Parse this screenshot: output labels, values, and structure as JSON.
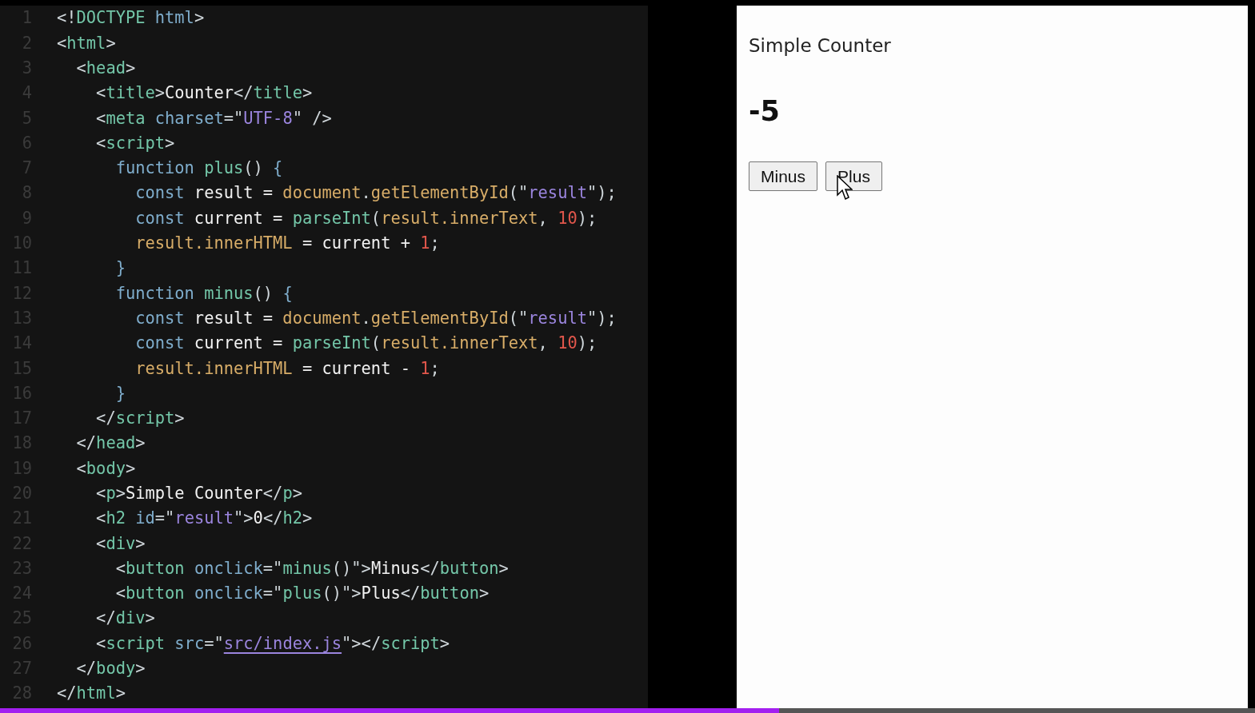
{
  "editor": {
    "lines": [
      {
        "n": "1",
        "tokens": [
          {
            "kind": "p",
            "text": "<!"
          },
          {
            "kind": "tag",
            "text": "DOCTYPE"
          },
          {
            "kind": "attr",
            "text": " html"
          },
          {
            "kind": "p",
            "text": ">"
          }
        ]
      },
      {
        "n": "2",
        "tokens": [
          {
            "kind": "p",
            "text": "<"
          },
          {
            "kind": "tag",
            "text": "html"
          },
          {
            "kind": "p",
            "text": ">"
          }
        ]
      },
      {
        "n": "3",
        "tokens": [
          {
            "kind": "p",
            "text": "  <"
          },
          {
            "kind": "tag",
            "text": "head"
          },
          {
            "kind": "p",
            "text": ">"
          }
        ]
      },
      {
        "n": "4",
        "tokens": [
          {
            "kind": "p",
            "text": "    <"
          },
          {
            "kind": "tag",
            "text": "title"
          },
          {
            "kind": "p",
            "text": ">"
          },
          {
            "kind": "txt",
            "text": "Counter"
          },
          {
            "kind": "p",
            "text": "</"
          },
          {
            "kind": "tag",
            "text": "title"
          },
          {
            "kind": "p",
            "text": ">"
          }
        ]
      },
      {
        "n": "5",
        "tokens": [
          {
            "kind": "p",
            "text": "    <"
          },
          {
            "kind": "tag",
            "text": "meta"
          },
          {
            "kind": "attr",
            "text": " charset"
          },
          {
            "kind": "p",
            "text": "=\""
          },
          {
            "kind": "str",
            "text": "UTF-8"
          },
          {
            "kind": "p",
            "text": "\" />"
          }
        ]
      },
      {
        "n": "6",
        "tokens": [
          {
            "kind": "p",
            "text": "    <"
          },
          {
            "kind": "tag",
            "text": "script"
          },
          {
            "kind": "p",
            "text": ">"
          }
        ]
      },
      {
        "n": "7",
        "tokens": [
          {
            "kind": "kw",
            "text": "      function"
          },
          {
            "kind": "fn",
            "text": " plus"
          },
          {
            "kind": "p",
            "text": "() "
          },
          {
            "kind": "kw",
            "text": "{"
          }
        ]
      },
      {
        "n": "8",
        "tokens": [
          {
            "kind": "kw",
            "text": "        const"
          },
          {
            "kind": "txt",
            "text": " result = "
          },
          {
            "kind": "obj",
            "text": "document"
          },
          {
            "kind": "p",
            "text": "."
          },
          {
            "kind": "obj",
            "text": "getElementById"
          },
          {
            "kind": "p",
            "text": "(\""
          },
          {
            "kind": "str",
            "text": "result"
          },
          {
            "kind": "p",
            "text": "\");"
          }
        ]
      },
      {
        "n": "9",
        "tokens": [
          {
            "kind": "kw",
            "text": "        const"
          },
          {
            "kind": "txt",
            "text": " current = "
          },
          {
            "kind": "fn",
            "text": "parseInt"
          },
          {
            "kind": "p",
            "text": "("
          },
          {
            "kind": "obj",
            "text": "result.innerText"
          },
          {
            "kind": "p",
            "text": ", "
          },
          {
            "kind": "num",
            "text": "10"
          },
          {
            "kind": "p",
            "text": ");"
          }
        ]
      },
      {
        "n": "10",
        "tokens": [
          {
            "kind": "obj",
            "text": "        result.innerHTML"
          },
          {
            "kind": "txt",
            "text": " = current + "
          },
          {
            "kind": "num",
            "text": "1"
          },
          {
            "kind": "p",
            "text": ";"
          }
        ]
      },
      {
        "n": "11",
        "tokens": [
          {
            "kind": "kw",
            "text": "      }"
          }
        ]
      },
      {
        "n": "12",
        "tokens": [
          {
            "kind": "kw",
            "text": "      function"
          },
          {
            "kind": "fn",
            "text": " minus"
          },
          {
            "kind": "p",
            "text": "() "
          },
          {
            "kind": "kw",
            "text": "{"
          }
        ]
      },
      {
        "n": "13",
        "tokens": [
          {
            "kind": "kw",
            "text": "        const"
          },
          {
            "kind": "txt",
            "text": " result = "
          },
          {
            "kind": "obj",
            "text": "document"
          },
          {
            "kind": "p",
            "text": "."
          },
          {
            "kind": "obj",
            "text": "getElementById"
          },
          {
            "kind": "p",
            "text": "(\""
          },
          {
            "kind": "str",
            "text": "result"
          },
          {
            "kind": "p",
            "text": "\");"
          }
        ]
      },
      {
        "n": "14",
        "tokens": [
          {
            "kind": "kw",
            "text": "        const"
          },
          {
            "kind": "txt",
            "text": " current = "
          },
          {
            "kind": "fn",
            "text": "parseInt"
          },
          {
            "kind": "p",
            "text": "("
          },
          {
            "kind": "obj",
            "text": "result.innerText"
          },
          {
            "kind": "p",
            "text": ", "
          },
          {
            "kind": "num",
            "text": "10"
          },
          {
            "kind": "p",
            "text": ");"
          }
        ]
      },
      {
        "n": "15",
        "tokens": [
          {
            "kind": "obj",
            "text": "        result.innerHTML"
          },
          {
            "kind": "txt",
            "text": " = current - "
          },
          {
            "kind": "num",
            "text": "1"
          },
          {
            "kind": "p",
            "text": ";"
          }
        ]
      },
      {
        "n": "16",
        "tokens": [
          {
            "kind": "kw",
            "text": "      }"
          }
        ]
      },
      {
        "n": "17",
        "tokens": [
          {
            "kind": "p",
            "text": "    </"
          },
          {
            "kind": "tag",
            "text": "script"
          },
          {
            "kind": "p",
            "text": ">"
          }
        ]
      },
      {
        "n": "18",
        "tokens": [
          {
            "kind": "p",
            "text": "  </"
          },
          {
            "kind": "tag",
            "text": "head"
          },
          {
            "kind": "p",
            "text": ">"
          }
        ]
      },
      {
        "n": "19",
        "tokens": [
          {
            "kind": "p",
            "text": "  <"
          },
          {
            "kind": "tag",
            "text": "body"
          },
          {
            "kind": "p",
            "text": ">"
          }
        ]
      },
      {
        "n": "20",
        "tokens": [
          {
            "kind": "p",
            "text": "    <"
          },
          {
            "kind": "tag",
            "text": "p"
          },
          {
            "kind": "p",
            "text": ">"
          },
          {
            "kind": "txt",
            "text": "Simple Counter"
          },
          {
            "kind": "p",
            "text": "</"
          },
          {
            "kind": "tag",
            "text": "p"
          },
          {
            "kind": "p",
            "text": ">"
          }
        ]
      },
      {
        "n": "21",
        "tokens": [
          {
            "kind": "p",
            "text": "    <"
          },
          {
            "kind": "tag",
            "text": "h2"
          },
          {
            "kind": "attr",
            "text": " id"
          },
          {
            "kind": "p",
            "text": "=\""
          },
          {
            "kind": "str",
            "text": "result"
          },
          {
            "kind": "p",
            "text": "\">"
          },
          {
            "kind": "txt",
            "text": "0"
          },
          {
            "kind": "p",
            "text": "</"
          },
          {
            "kind": "tag",
            "text": "h2"
          },
          {
            "kind": "p",
            "text": ">"
          }
        ]
      },
      {
        "n": "22",
        "tokens": [
          {
            "kind": "p",
            "text": "    <"
          },
          {
            "kind": "tag",
            "text": "div"
          },
          {
            "kind": "p",
            "text": ">"
          }
        ]
      },
      {
        "n": "23",
        "tokens": [
          {
            "kind": "p",
            "text": "      <"
          },
          {
            "kind": "tag",
            "text": "button"
          },
          {
            "kind": "attr",
            "text": " onclick"
          },
          {
            "kind": "p",
            "text": "=\""
          },
          {
            "kind": "fn",
            "text": "minus"
          },
          {
            "kind": "p",
            "text": "()\">"
          },
          {
            "kind": "txt",
            "text": "Minus"
          },
          {
            "kind": "p",
            "text": "</"
          },
          {
            "kind": "tag",
            "text": "button"
          },
          {
            "kind": "p",
            "text": ">"
          }
        ]
      },
      {
        "n": "24",
        "tokens": [
          {
            "kind": "p",
            "text": "      <"
          },
          {
            "kind": "tag",
            "text": "button"
          },
          {
            "kind": "attr",
            "text": " onclick"
          },
          {
            "kind": "p",
            "text": "=\""
          },
          {
            "kind": "fn",
            "text": "plus"
          },
          {
            "kind": "p",
            "text": "()\">"
          },
          {
            "kind": "txt",
            "text": "Plus"
          },
          {
            "kind": "p",
            "text": "</"
          },
          {
            "kind": "tag",
            "text": "button"
          },
          {
            "kind": "p",
            "text": ">"
          }
        ]
      },
      {
        "n": "25",
        "tokens": [
          {
            "kind": "p",
            "text": "    </"
          },
          {
            "kind": "tag",
            "text": "div"
          },
          {
            "kind": "p",
            "text": ">"
          }
        ]
      },
      {
        "n": "26",
        "tokens": [
          {
            "kind": "p",
            "text": "    <"
          },
          {
            "kind": "tag",
            "text": "script"
          },
          {
            "kind": "attr",
            "text": " src"
          },
          {
            "kind": "p",
            "text": "=\""
          },
          {
            "kind": "link",
            "text": "src/index.js"
          },
          {
            "kind": "p",
            "text": "\"></"
          },
          {
            "kind": "tag",
            "text": "script"
          },
          {
            "kind": "p",
            "text": ">"
          }
        ]
      },
      {
        "n": "27",
        "tokens": [
          {
            "kind": "p",
            "text": "  </"
          },
          {
            "kind": "tag",
            "text": "body"
          },
          {
            "kind": "p",
            "text": ">"
          }
        ]
      },
      {
        "n": "28",
        "tokens": [
          {
            "kind": "p",
            "text": "</"
          },
          {
            "kind": "tag",
            "text": "html"
          },
          {
            "kind": "p",
            "text": ">"
          }
        ]
      }
    ]
  },
  "preview": {
    "paragraph": "Simple Counter",
    "result": "-5",
    "buttons": [
      "Minus",
      "Plus"
    ]
  },
  "progress": {
    "level": 0.621
  }
}
